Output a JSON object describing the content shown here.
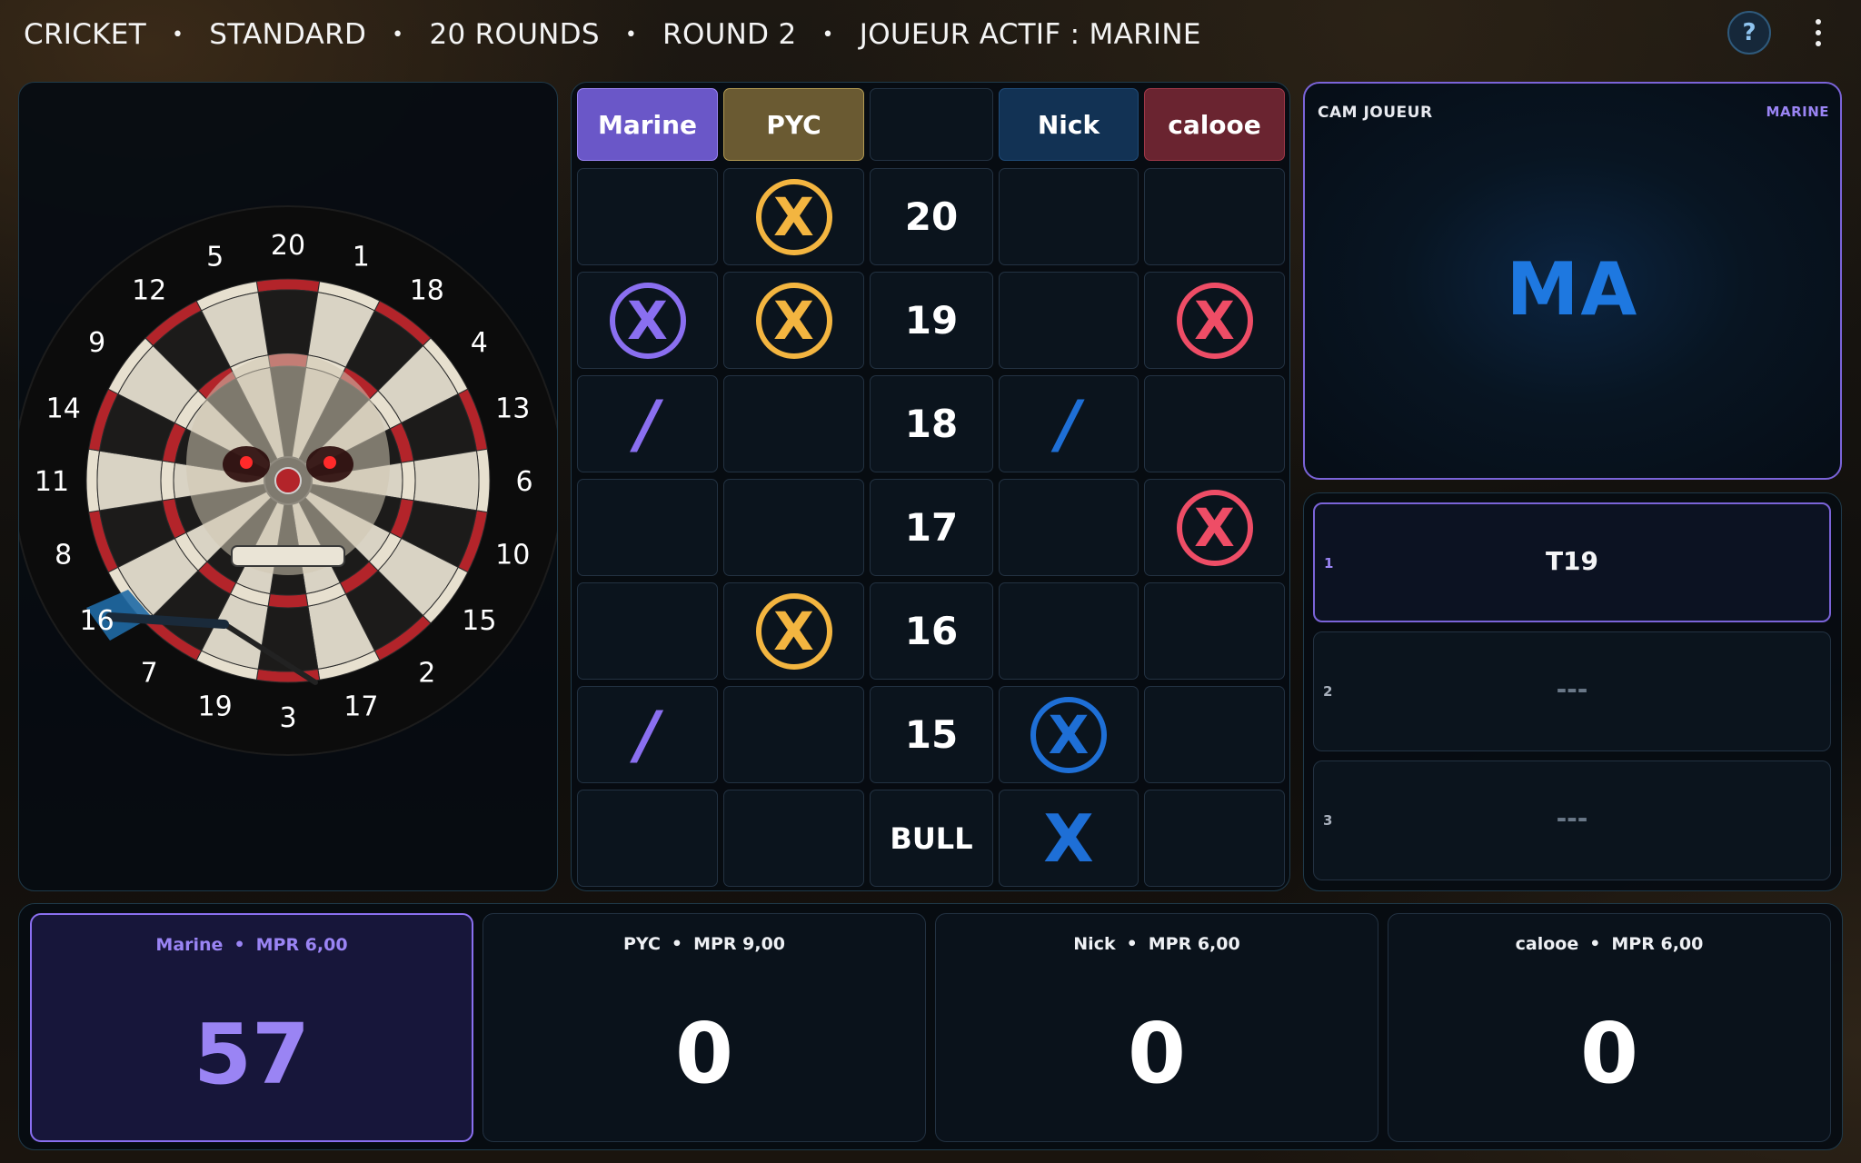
{
  "header": {
    "game": "CRICKET",
    "mode": "STANDARD",
    "rounds": "20 ROUNDS",
    "round": "ROUND 2",
    "active_player": "JOUEUR ACTIF : MARINE",
    "help_icon": "?"
  },
  "colors": {
    "marine": "#8a6ff0",
    "pyc": "#f3b540",
    "nick": "#1e6fd6",
    "calooe": "#ee4d66"
  },
  "dartboard": {
    "numbers": [
      "20",
      "1",
      "18",
      "4",
      "13",
      "6",
      "10",
      "15",
      "2",
      "17",
      "3",
      "19",
      "7",
      "16",
      "8",
      "11",
      "14",
      "9",
      "12",
      "5"
    ]
  },
  "grid": {
    "players": [
      {
        "name": "Marine"
      },
      {
        "name": "PYC"
      },
      {
        "name": ""
      },
      {
        "name": "Nick"
      },
      {
        "name": "calooe"
      }
    ],
    "targets": [
      "20",
      "19",
      "18",
      "17",
      "16",
      "15",
      "BULL"
    ],
    "marks": {
      "marine": [
        "",
        "circle",
        "slash",
        "",
        "",
        "slash",
        ""
      ],
      "pyc": [
        "circle",
        "circle",
        "",
        "",
        "circle",
        "",
        ""
      ],
      "nick": [
        "",
        "",
        "slash",
        "",
        "",
        "circle",
        "x"
      ],
      "calooe": [
        "",
        "circle",
        "",
        "circle",
        "",
        "",
        ""
      ]
    },
    "x_glyph": "X",
    "slash_glyph": "/"
  },
  "cam": {
    "title": "CAM JOUEUR",
    "player": "MARINE",
    "initials": "MA"
  },
  "throws": [
    {
      "index": "1",
      "value": "T19"
    },
    {
      "index": "2",
      "value": "---"
    },
    {
      "index": "3",
      "value": "---"
    }
  ],
  "scores": [
    {
      "name": "Marine",
      "mpr": "MPR 6,00",
      "points": "57"
    },
    {
      "name": "PYC",
      "mpr": "MPR 9,00",
      "points": "0"
    },
    {
      "name": "Nick",
      "mpr": "MPR 6,00",
      "points": "0"
    },
    {
      "name": "calooe",
      "mpr": "MPR 6,00",
      "points": "0"
    }
  ],
  "bullet_sep": "•"
}
